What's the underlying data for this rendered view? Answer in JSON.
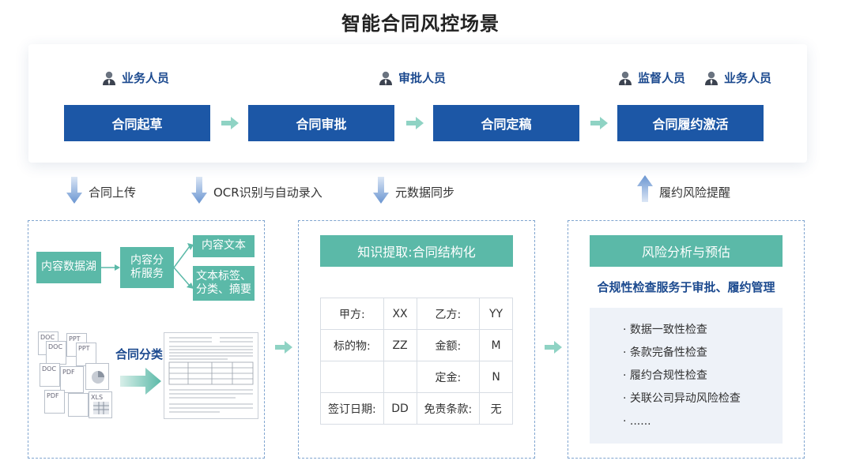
{
  "title": "智能合同风控场景",
  "roles": {
    "business": "业务人员",
    "approver": "审批人员",
    "supervisor": "监督人员",
    "business2": "业务人员"
  },
  "stages": [
    "合同起草",
    "合同审批",
    "合同定稿",
    "合同履约激活"
  ],
  "flow_labels": {
    "upload": "合同上传",
    "ocr": "OCR识别与自动录入",
    "meta": "元数据同步",
    "alert": "履约风险提醒"
  },
  "left_panel": {
    "lake": "内容数据湖",
    "service_line1": "内容分",
    "service_line2": "析服务",
    "text": "内容文本",
    "tags_line1": "文本标签、",
    "tags_line2": "分类、摘要",
    "classify": "合同分类",
    "doc_types": [
      "DOC",
      "DOC",
      "PPT",
      "PPT",
      "DOC",
      "PDF",
      "XLS",
      "PDF"
    ]
  },
  "middle_panel": {
    "header": "知识提取:合同结构化",
    "rows": [
      [
        "甲方:",
        "XX",
        "乙方:",
        "YY"
      ],
      [
        "标的物:",
        "ZZ",
        "金额:",
        "M"
      ],
      [
        "",
        "",
        "定金:",
        "N"
      ],
      [
        "签订日期:",
        "DD",
        "免责条款:",
        "无"
      ]
    ]
  },
  "right_panel": {
    "header": "风险分析与预估",
    "subtitle": "合规性检查服务于审批、履约管理",
    "checks": [
      "· 数据一致性检查",
      "· 条款完备性检查",
      "· 履约合规性检查",
      "· 关联公司异动风险检查",
      "· ......"
    ]
  },
  "colors": {
    "stage_blue": "#1c57a6",
    "teal": "#5bb9a8",
    "role_blue": "#1c4a8f"
  }
}
